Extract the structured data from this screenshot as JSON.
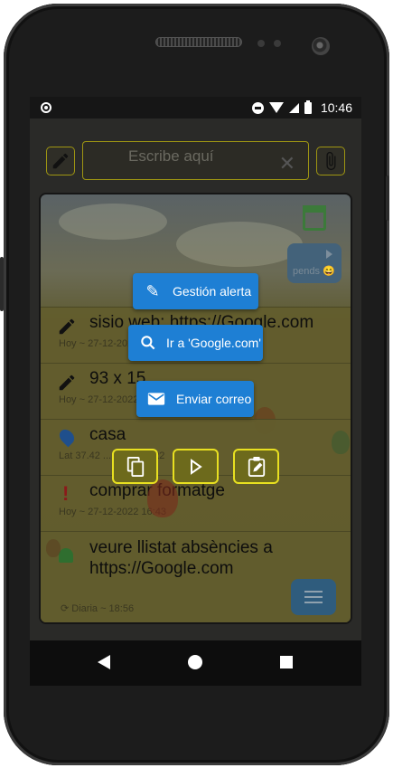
{
  "status_bar": {
    "time": "10:46"
  },
  "input": {
    "placeholder": "Escribe aquí",
    "clear_icon": "close-icon"
  },
  "panel": {
    "pending_label": "pends 😄",
    "items": [
      {
        "title": "sisio web: https://Google.com",
        "subtitle": "Hoy ~ 27-12-2022",
        "icon": "pencil-icon"
      },
      {
        "title": "93 x 15",
        "subtitle": "Hoy ~ 27-12-2022",
        "icon": "pencil-icon"
      },
      {
        "title": "casa",
        "subtitle": "Lat 37.42 ... 27-12-2022",
        "icon": "location-pin-icon"
      },
      {
        "title": "comprar formatge",
        "subtitle": "Hoy ~ 27-12-2022 16:43",
        "icon": "exclamation-icon"
      },
      {
        "title": "veure llistat absències a https://Google.com",
        "subtitle": "Diaria ~ 18:56",
        "icon": "bell-icon"
      }
    ]
  },
  "context_menu": {
    "alert_label": "Gestión alerta",
    "search_label": "Ir a 'Google.com'",
    "email_label": "Enviar correo"
  },
  "action_buttons": [
    "copy-icon",
    "play-icon",
    "edit-clipboard-icon"
  ],
  "colors": {
    "accent_blue": "#1e7fd4",
    "border_yellow": "#e8e020",
    "panel_olive": "#625d2d"
  }
}
